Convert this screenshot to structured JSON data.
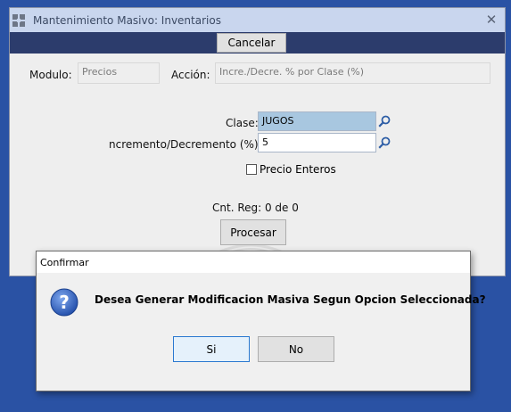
{
  "main_window": {
    "title": "Mantenimiento Masivo: Inventarios",
    "close_glyph": "✕",
    "app_icon": "app-logo-icon",
    "toolbar": {
      "cancel_label": "Cancelar"
    },
    "fields": {
      "modulo_label": "Modulo:",
      "modulo_value": "Precios",
      "accion_label": "Acción:",
      "accion_value": "Incre./Decre. % por Clase (%)",
      "clase_label": "Clase:",
      "clase_value": "JUGOS",
      "incremento_label": "ncremento/Decremento (%):",
      "incremento_value": "5",
      "precio_enteros_label": "Precio Enteros",
      "precio_enteros_checked": false
    },
    "count_label": "Cnt. Reg: 0 de 0",
    "process_label": "Procesar",
    "search_icon": "magnifier-icon"
  },
  "confirm_dialog": {
    "title": "Confirmar",
    "message": "Desea Generar Modificacion Masiva Segun Opcion Seleccionada?",
    "icon": "question-icon",
    "yes_label": "Si",
    "no_label": "No"
  },
  "colors": {
    "desktop": "#2a52a4",
    "toolbar": "#2c3c6c",
    "title_bar": "#c9d6ee",
    "selected_input": "#a8c7e0",
    "question_icon": "#2f5fc4"
  }
}
